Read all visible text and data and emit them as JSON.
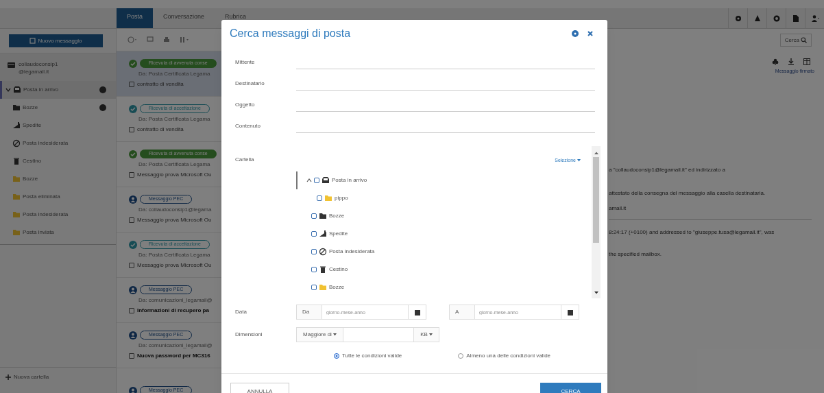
{
  "top_bar": {
    "tabs": [
      {
        "label": "Posta",
        "selected": true
      },
      {
        "label": "Conversazione",
        "selected": false
      },
      {
        "label": "Rubrica",
        "selected": false
      }
    ]
  },
  "sidebar": {
    "new_message_button": "Nuovo messaggio",
    "account_lines": [
      "collaudoconsip1",
      "@legamail.it"
    ],
    "folders": [
      {
        "label": "Posta in arrivo",
        "kind": "inbox",
        "selected": true,
        "expanded": true,
        "badge": true
      },
      {
        "label": "Bozze",
        "kind": "drafts",
        "selected": false,
        "badge": true
      },
      {
        "label": "Spedite",
        "kind": "sent",
        "selected": false,
        "badge": false
      },
      {
        "label": "Posta indesiderata",
        "kind": "spam",
        "selected": false,
        "badge": false
      },
      {
        "label": "Cestino",
        "kind": "trash",
        "selected": false,
        "badge": false
      },
      {
        "label": "Bozze",
        "kind": "folder",
        "selected": false,
        "badge": false
      },
      {
        "label": "Posta eliminata",
        "kind": "folder",
        "selected": false,
        "badge": false
      },
      {
        "label": "Posta indesiderata",
        "kind": "folder",
        "selected": false,
        "badge": false
      },
      {
        "label": "Posta inviata",
        "kind": "folder",
        "selected": false,
        "badge": false
      }
    ],
    "new_folder": "Nuova cartella"
  },
  "message_list": {
    "messages": [
      {
        "kind": "delivered",
        "tag": "Ricevuta di avvenuta conse",
        "from": "Da: Posta Certificata Legama",
        "subject": "contratto di vendita",
        "selected": true,
        "unread": false
      },
      {
        "kind": "accepted",
        "tag": "Ricevuta di accettazione",
        "from": "Da: Posta Certificata Legama",
        "subject": "contratto di vendita",
        "selected": false,
        "unread": false
      },
      {
        "kind": "delivered",
        "tag": "Ricevuta di avvenuta conse",
        "from": "Da: Posta Certificata Legama",
        "subject": "Messaggio prova Microsoft Ou",
        "selected": false,
        "unread": false
      },
      {
        "kind": "pec",
        "tag": "Messaggio PEC",
        "from": "Da: collaudoconsip1@legama",
        "subject": "Messaggio prova Microsoft Ou",
        "selected": false,
        "unread": false
      },
      {
        "kind": "accepted",
        "tag": "Ricevuta di accettazione",
        "from": "Da: Posta Certificata Legama",
        "subject": "Messaggio prova Microsoft Ou",
        "selected": false,
        "unread": false
      },
      {
        "kind": "pec",
        "tag": "Messaggio PEC",
        "from": "Da: comunicazioni_legamail@",
        "subject": "Informazioni di recupero pa",
        "selected": false,
        "unread": true
      },
      {
        "kind": "pec",
        "tag": "Messaggio PEC",
        "from": "Da: comunicazioni_legamail@",
        "subject": "Nuova password per MC316",
        "selected": false,
        "unread": true
      },
      {
        "kind": "pec",
        "tag": "Messaggio PEC"
      }
    ]
  },
  "reading_pane": {
    "search_button": "Cerca",
    "signed_link": "Messaggio firmato",
    "paragraphs": [
      "a \"collaudoconsip1@legamail.it\" ed indirizzato a",
      "attestato della consegna del messaggio alla casella destinataria.",
      "amail.it",
      "8:24:17 (+0100) and addressed to \"giuseppe.tusa@legamail.it\", was",
      "the specified mailbox."
    ]
  },
  "dialog": {
    "title": "Cerca messaggi di posta",
    "text_fields": [
      {
        "label": "Mittente"
      },
      {
        "label": "Destinatario"
      },
      {
        "label": "Oggetto"
      },
      {
        "label": "Contenuto"
      }
    ],
    "folder_field": {
      "label": "Cartella",
      "select_link": "Selezione",
      "tree": [
        {
          "label": "Posta in arrivo",
          "kind": "inbox",
          "checked": false,
          "expanded": true,
          "children": [
            {
              "label": "pippo",
              "kind": "folder",
              "checked": false
            }
          ]
        },
        {
          "label": "Bozze",
          "kind": "drafts",
          "checked": false
        },
        {
          "label": "Spedite",
          "kind": "sent",
          "checked": false
        },
        {
          "label": "Posta indesiderata",
          "kind": "spam",
          "checked": false
        },
        {
          "label": "Cestino",
          "kind": "trash",
          "checked": false
        },
        {
          "label": "Bozze",
          "kind": "folder",
          "checked": false
        }
      ]
    },
    "date_field": {
      "label": "Data",
      "from_addon": "Da",
      "from_placeholder": "giorno-mese-anno",
      "to_addon": "A",
      "to_placeholder": "giorno-mese-anno"
    },
    "size_field": {
      "label": "Dimensioni",
      "operator": "Maggiore di",
      "unit": "KB"
    },
    "match_options": [
      {
        "label": "Tutte le condizioni valide",
        "selected": true
      },
      {
        "label": "Almeno una delle condizioni valide",
        "selected": false
      }
    ],
    "cancel_button": "ANNULLA",
    "search_button": "CERCA"
  }
}
